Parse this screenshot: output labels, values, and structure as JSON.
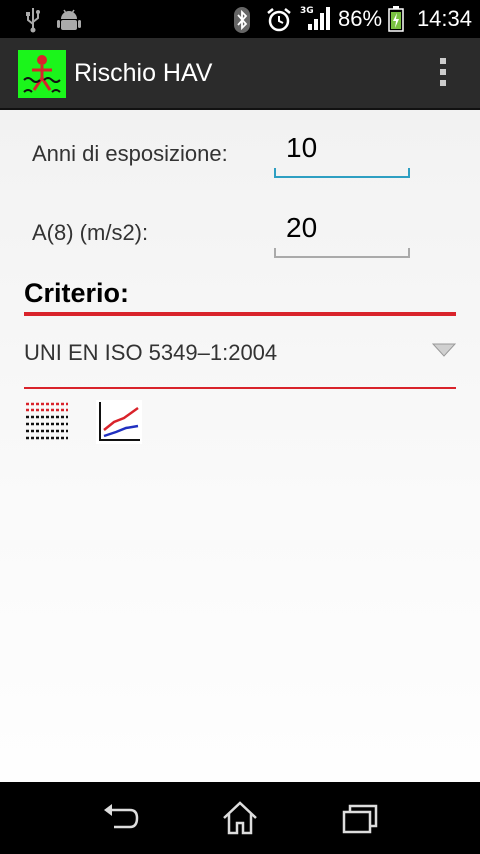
{
  "status_bar": {
    "time": "14:34",
    "battery_percent": "86%",
    "network_type": "3G",
    "icons": [
      "usb-icon",
      "android-debug-icon",
      "bluetooth-icon",
      "alarm-clock-icon",
      "signal-icon",
      "battery-charging-icon"
    ]
  },
  "action_bar": {
    "title": "Rischio HAV",
    "app_icon": "hand-vibration-app-icon",
    "menu_icon": "overflow-menu-icon"
  },
  "form": {
    "years_label": "Anni di esposizione:",
    "years_value": "10",
    "a8_label": "A(8) (m/s2):",
    "a8_value": "20"
  },
  "criterio": {
    "header": "Criterio:",
    "selected": "UNI EN ISO 5349–1:2004"
  },
  "tools": [
    "table-view-icon",
    "chart-view-icon"
  ],
  "nav_bar": {
    "icons": [
      "back-icon",
      "home-icon",
      "recent-apps-icon"
    ]
  },
  "colors": {
    "accent_red": "#d9232b",
    "focus_blue": "#2e9fc2",
    "app_icon_green": "#1bf51b",
    "action_bar": "#2b2b2b"
  }
}
